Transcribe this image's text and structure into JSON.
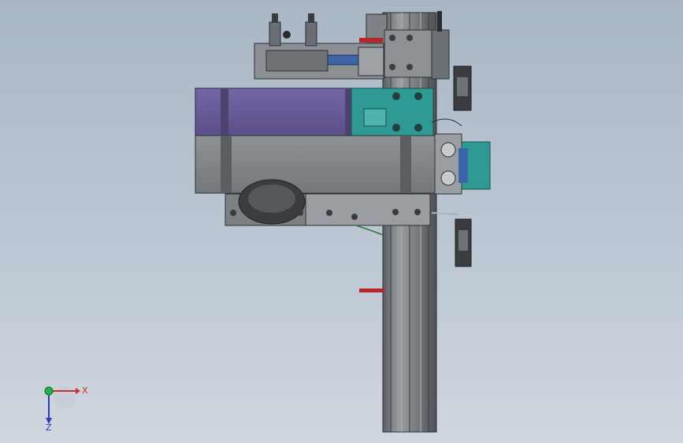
{
  "app": {
    "view": "cad-3d-viewport",
    "background_top": "#a9b6c6",
    "background_bottom": "#cfd6de"
  },
  "colors": {
    "steel": "#8a8d91",
    "steel_dark": "#55585c",
    "violet": "#6a5c98",
    "teal": "#2f9a94",
    "blue": "#3d66a8",
    "red_sensor": "#b3262a",
    "green_wire": "#2f7a3a"
  },
  "triad": {
    "x_label": "X",
    "z_label": "Z",
    "x_color": "#d22b2b",
    "z_color": "#2a3db8",
    "y_color": "#22b14c"
  },
  "icons": [
    "coordinate-triad-icon"
  ]
}
